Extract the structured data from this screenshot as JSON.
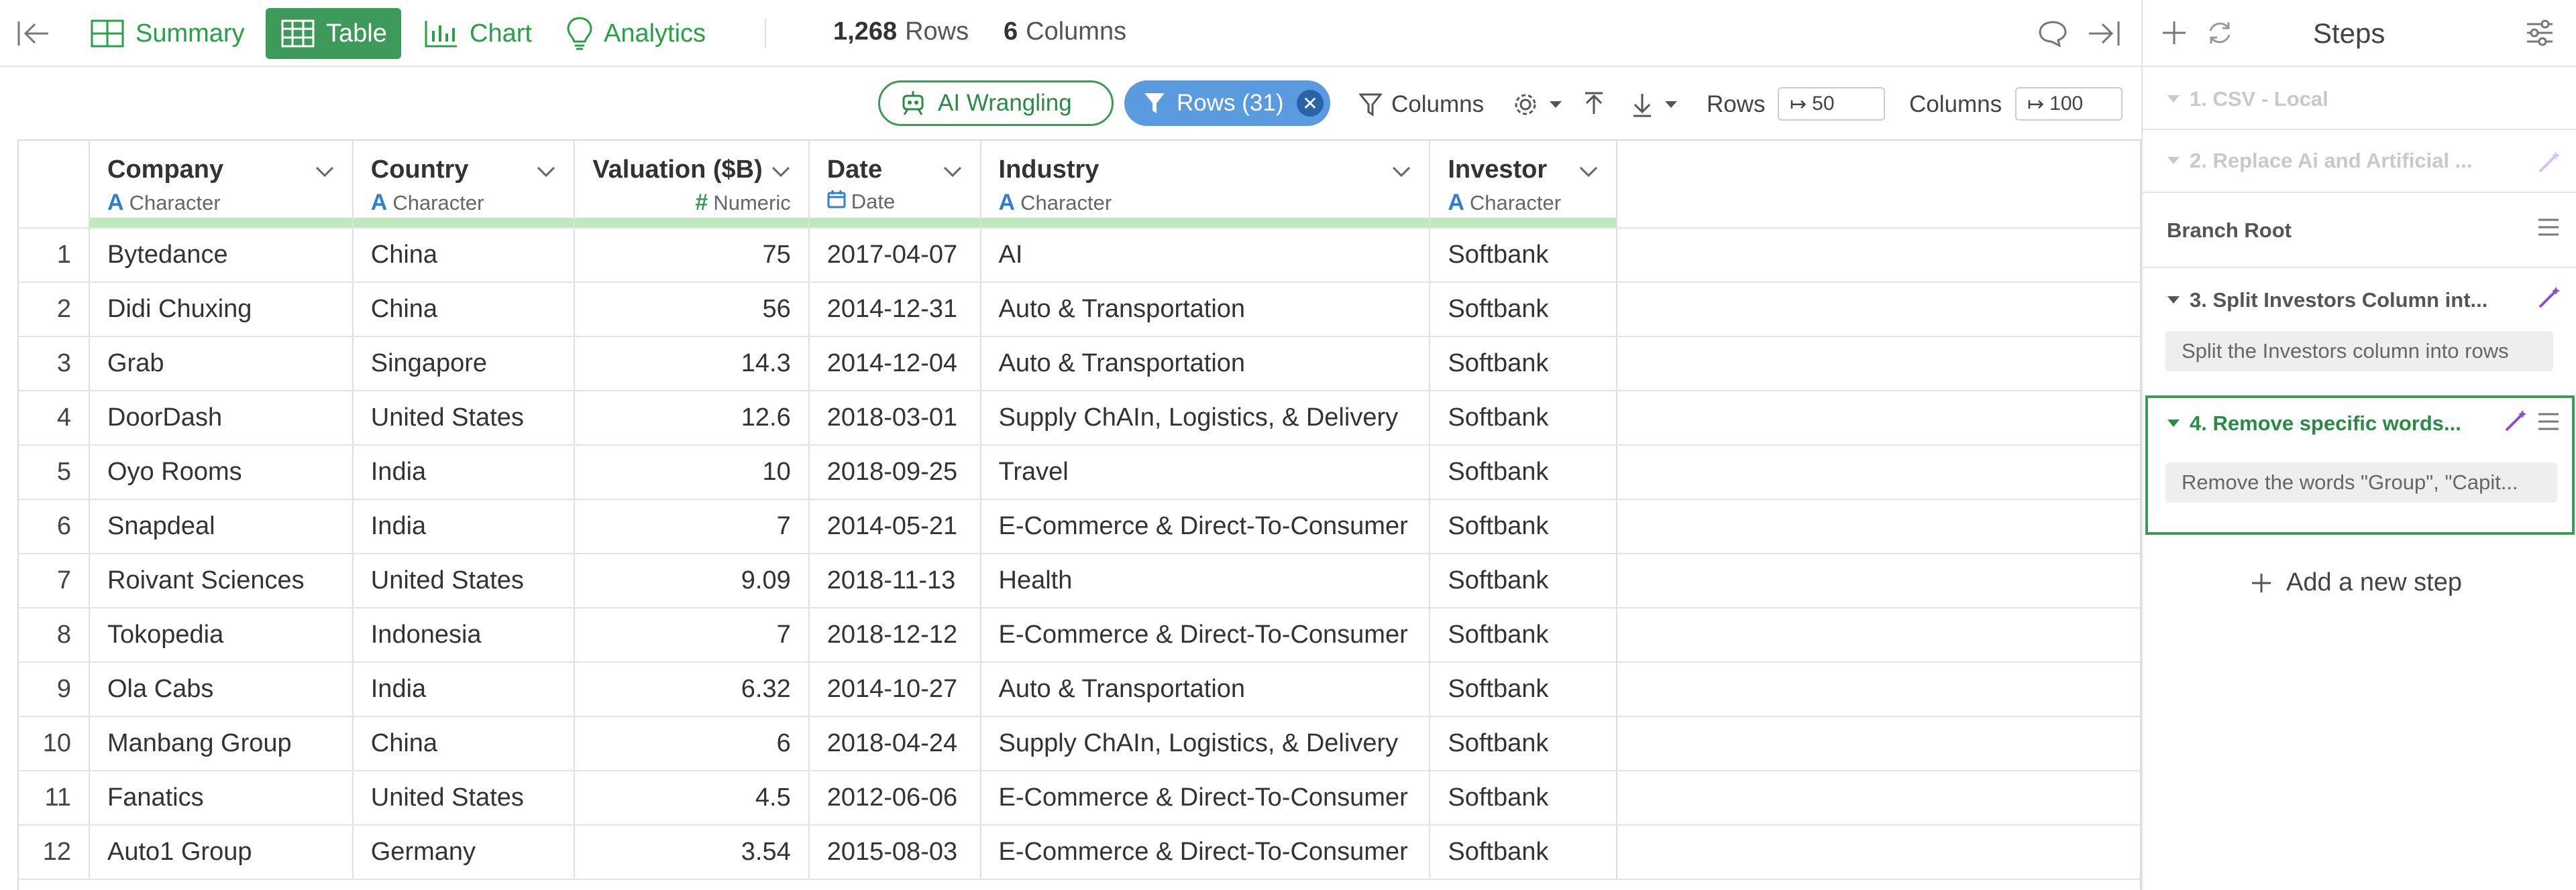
{
  "topbar": {
    "tabs": [
      {
        "label": "Summary",
        "icon": "summary-grid-icon",
        "active": false
      },
      {
        "label": "Table",
        "icon": "table-icon",
        "active": true
      },
      {
        "label": "Chart",
        "icon": "bar-chart-icon",
        "active": false
      },
      {
        "label": "Analytics",
        "icon": "lightbulb-icon",
        "active": false
      }
    ],
    "rows_count": "1,268",
    "rows_word": "Rows",
    "cols_count": "6",
    "cols_word": "Columns"
  },
  "toolbar": {
    "ai_label": "AI Wrangling",
    "rows_filter_label": "Rows (31)",
    "columns_label": "Columns",
    "rows_label": "Rows",
    "rows_limit": "50",
    "columns_label2": "Columns",
    "columns_limit": "100"
  },
  "table": {
    "columns": [
      {
        "name": "Company",
        "type": "Character",
        "type_glyph": "A"
      },
      {
        "name": "Country",
        "type": "Character",
        "type_glyph": "A"
      },
      {
        "name": "Valuation ($B)",
        "type": "Numeric",
        "type_glyph": "#"
      },
      {
        "name": "Date",
        "type": "Date",
        "type_glyph": "date-icon"
      },
      {
        "name": "Industry",
        "type": "Character",
        "type_glyph": "A"
      },
      {
        "name": "Investor",
        "type": "Character",
        "type_glyph": "A"
      }
    ],
    "rows": [
      {
        "i": "1",
        "company": "Bytedance",
        "country": "China",
        "valuation": "75",
        "date": "2017-04-07",
        "industry": "AI",
        "investor": "Softbank"
      },
      {
        "i": "2",
        "company": "Didi Chuxing",
        "country": "China",
        "valuation": "56",
        "date": "2014-12-31",
        "industry": "Auto & Transportation",
        "investor": "Softbank"
      },
      {
        "i": "3",
        "company": "Grab",
        "country": "Singapore",
        "valuation": "14.3",
        "date": "2014-12-04",
        "industry": "Auto & Transportation",
        "investor": "Softbank"
      },
      {
        "i": "4",
        "company": "DoorDash",
        "country": "United States",
        "valuation": "12.6",
        "date": "2018-03-01",
        "industry": "Supply ChAIn, Logistics, & Delivery",
        "investor": "Softbank"
      },
      {
        "i": "5",
        "company": "Oyo Rooms",
        "country": "India",
        "valuation": "10",
        "date": "2018-09-25",
        "industry": "Travel",
        "investor": "Softbank"
      },
      {
        "i": "6",
        "company": "Snapdeal",
        "country": "India",
        "valuation": "7",
        "date": "2014-05-21",
        "industry": "E-Commerce & Direct-To-Consumer",
        "investor": "Softbank"
      },
      {
        "i": "7",
        "company": "Roivant Sciences",
        "country": "United States",
        "valuation": "9.09",
        "date": "2018-11-13",
        "industry": "Health",
        "investor": "Softbank"
      },
      {
        "i": "8",
        "company": "Tokopedia",
        "country": "Indonesia",
        "valuation": "7",
        "date": "2018-12-12",
        "industry": "E-Commerce & Direct-To-Consumer",
        "investor": "Softbank"
      },
      {
        "i": "9",
        "company": "Ola Cabs",
        "country": "India",
        "valuation": "6.32",
        "date": "2014-10-27",
        "industry": "Auto & Transportation",
        "investor": "Softbank"
      },
      {
        "i": "10",
        "company": "Manbang Group",
        "country": "China",
        "valuation": "6",
        "date": "2018-04-24",
        "industry": "Supply ChAIn, Logistics, & Delivery",
        "investor": "Softbank"
      },
      {
        "i": "11",
        "company": "Fanatics",
        "country": "United States",
        "valuation": "4.5",
        "date": "2012-06-06",
        "industry": "E-Commerce & Direct-To-Consumer",
        "investor": "Softbank"
      },
      {
        "i": "12",
        "company": "Auto1 Group",
        "country": "Germany",
        "valuation": "3.54",
        "date": "2015-08-03",
        "industry": "E-Commerce & Direct-To-Consumer",
        "investor": "Softbank"
      }
    ]
  },
  "steps": {
    "title": "Steps",
    "items": [
      {
        "label": "1. CSV - Local"
      },
      {
        "label": "2. Replace Ai and Artificial ..."
      },
      {
        "label": "Branch Root"
      },
      {
        "label": "3. Split Investors Column int...",
        "desc": "Split the Investors column into rows"
      },
      {
        "label": "4. Remove specific words...",
        "desc": "Remove the words \"Group\", \"Capit..."
      }
    ],
    "add_label": "Add a new step"
  },
  "colors": {
    "accent_green": "#3d9a5a",
    "filter_blue": "#5a9be0",
    "type_blue": "#2f7fd1",
    "wand_purple": "#8a4fd0"
  }
}
